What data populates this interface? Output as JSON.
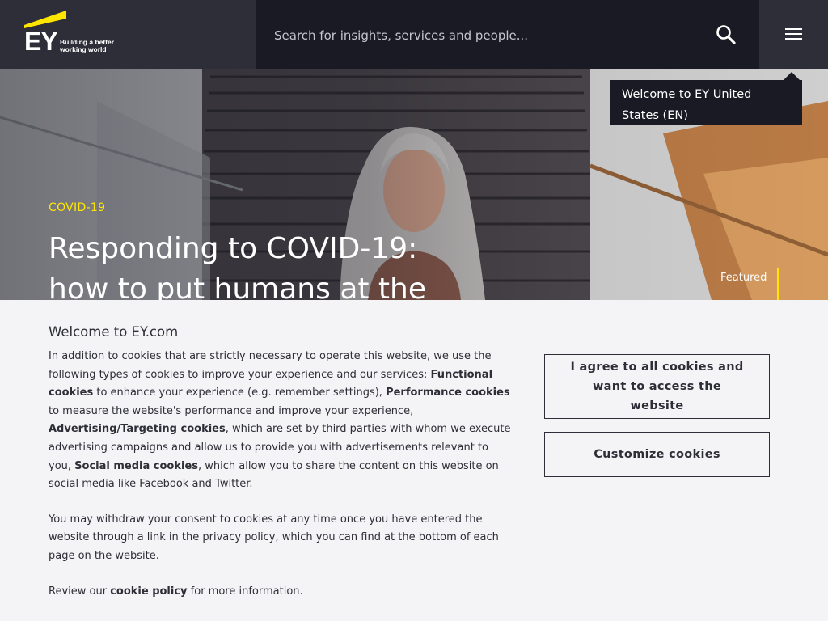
{
  "header": {
    "logo_text": "EY",
    "logo_tagline": "Building a better working world",
    "search_placeholder": "Search for insights, services and people...",
    "search_icon": "search-icon",
    "menu_icon": "hamburger-menu-icon"
  },
  "hero": {
    "eyebrow": "COVID-19",
    "title": "Responding to COVID-19: how to put humans at the",
    "featured_label": "Featured"
  },
  "tooltip": {
    "text": "Welcome to EY United States (EN)"
  },
  "cookie_banner": {
    "title": "Welcome to EY.com",
    "p1_intro": "In addition to cookies that are strictly necessary to operate this website, we use the following types of cookies to improve your experience and our services: ",
    "functional_label": "Functional cookies",
    "functional_desc": " to enhance your experience (e.g. remember settings), ",
    "performance_label": "Performance cookies",
    "performance_desc": " to measure the website's performance and improve your experience, ",
    "advertising_label": "Advertising/Targeting cookies",
    "advertising_desc": ", which are set by third parties with whom we execute advertising campaigns and allow us to provide you with advertisements relevant to you,  ",
    "social_label": "Social media cookies",
    "social_desc": ", which allow you to share the content on this website on social media like Facebook and Twitter.",
    "p2": "You may withdraw your consent to cookies at any time once you have entered the website through a link in the privacy policy, which you can find at the bottom of each page on the website.",
    "p3_before": "Review our ",
    "policy_link": "cookie policy",
    "p3_after": " for more information.",
    "agree_button": "I agree to all cookies and want to access the website",
    "customize_button": "Customize cookies"
  },
  "colors": {
    "brand_yellow": "#ffe600",
    "header_bg": "#2e2e38",
    "search_bg": "#1a1a24",
    "banner_bg": "#f4f4f6"
  }
}
